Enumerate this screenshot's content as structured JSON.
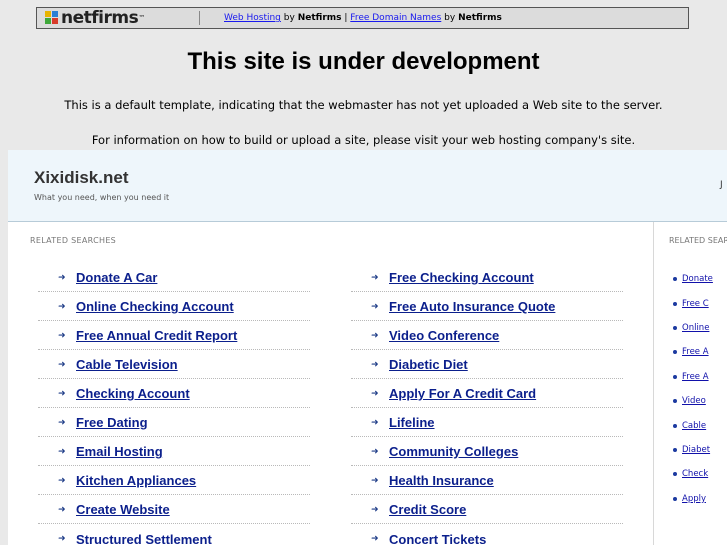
{
  "banner": {
    "logo_text": "netfirms",
    "logo_tm": "™",
    "link1": "Web Hosting",
    "by1": "by",
    "brand1": "Netfirms",
    "divider": "|",
    "link2": "Free Domain Names",
    "by2": "by",
    "brand2": "Netfirms"
  },
  "heading": "This site is under development",
  "notice1": "This is a default template, indicating that the webmaster has not yet uploaded a Web site to the server.",
  "notice2": "For information on how to build or upload a site, please visit your web hosting company's site.",
  "site": {
    "name": "Xixidisk.net",
    "tagline": "What you need, when you need it",
    "header_right": "J"
  },
  "related_label": "RELATED SEARCHES",
  "related_label_right": "RELATED SEARCHES",
  "arrow_glyph": "➜",
  "left_column": [
    "Donate A Car",
    "Online Checking Account",
    "Free Annual Credit Report",
    "Cable Television",
    "Checking Account",
    "Free Dating",
    "Email Hosting",
    "Kitchen Appliances",
    "Create Website",
    "Structured Settlement"
  ],
  "right_column": [
    "Free Checking Account",
    "Free Auto Insurance Quote",
    "Video Conference",
    "Diabetic Diet",
    "Apply For A Credit Card",
    "Lifeline",
    "Community Colleges",
    "Health Insurance",
    "Credit Score",
    "Concert Tickets"
  ],
  "side_list": [
    "Donate",
    "Free C",
    "Online",
    "Free A",
    "Free A",
    "Video",
    "Cable",
    "Diabet",
    "Check",
    "Apply"
  ],
  "colors": {
    "link": "#0b1f8c",
    "header_bg": "#eef6fb",
    "page_bg": "#e9e9e9"
  }
}
